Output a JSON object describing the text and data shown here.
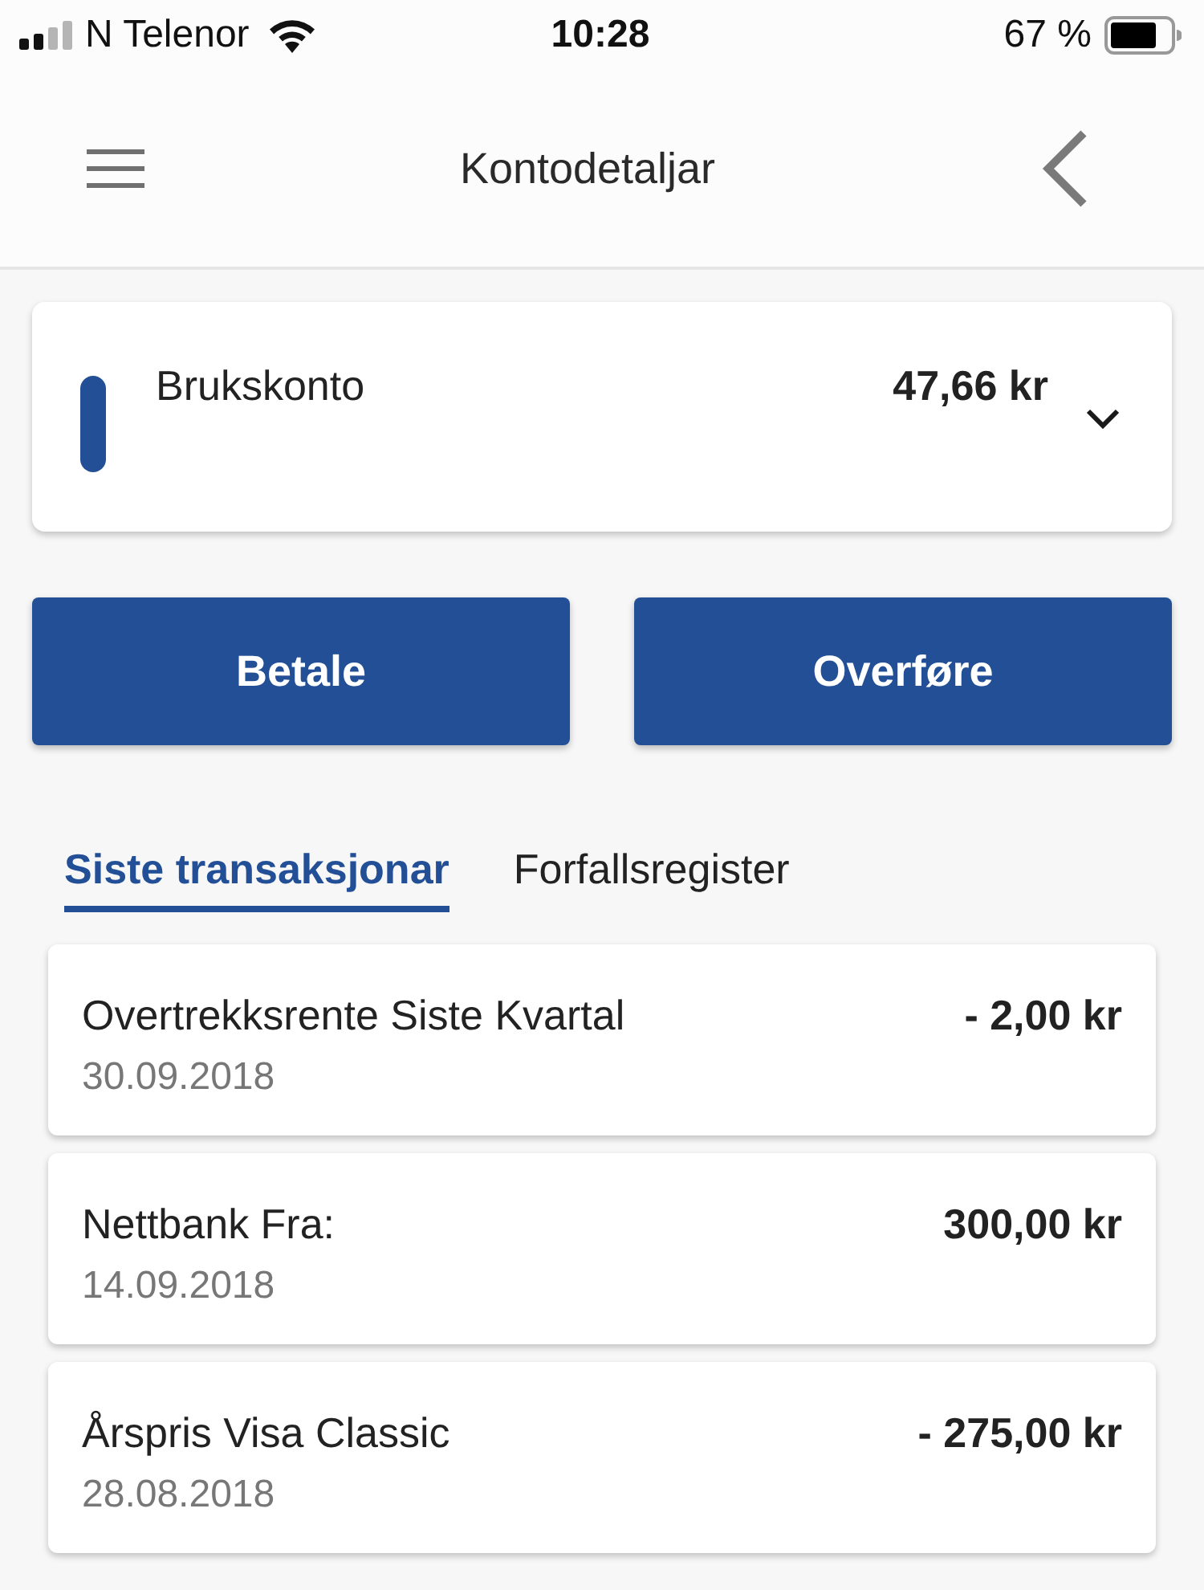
{
  "status_bar": {
    "carrier": "N Telenor",
    "time": "10:28",
    "battery": "67 %"
  },
  "nav_bar": {
    "title": "Kontodetaljar"
  },
  "account": {
    "name": "Brukskonto",
    "balance": "47,66 kr"
  },
  "actions": [
    "Betale",
    "Overføre"
  ],
  "tabs": [
    {
      "label": "Siste transaksjonar",
      "selected": true
    },
    {
      "label": "Forfallsregister",
      "selected": false
    }
  ],
  "transactions": [
    {
      "title": "Overtrekksrente Siste Kvartal",
      "date": "30.09.2018",
      "amount": "- 2,00 kr"
    },
    {
      "title": "Nettbank Fra:",
      "date": "14.09.2018",
      "amount": "300,00 kr"
    },
    {
      "title": "Årspris Visa Classic",
      "date": "28.08.2018",
      "amount": "- 275,00 kr"
    }
  ]
}
